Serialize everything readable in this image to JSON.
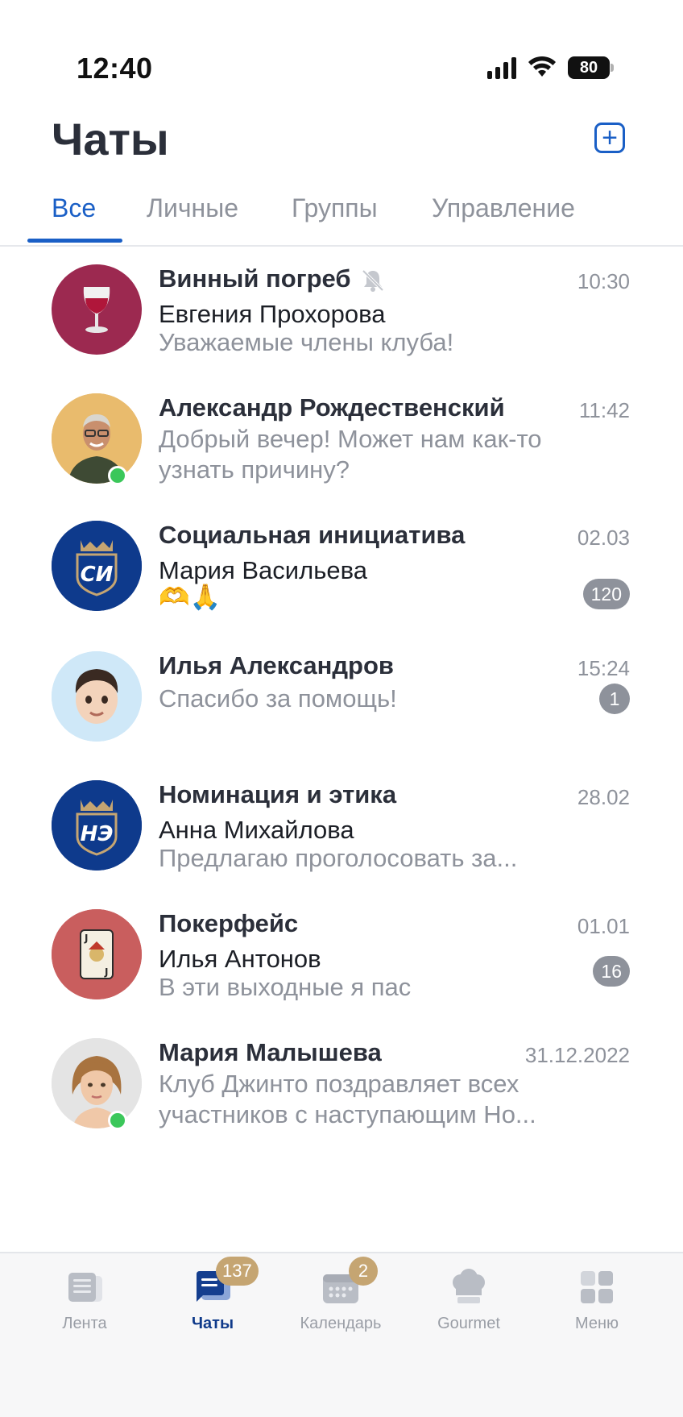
{
  "status_bar": {
    "time": "12:40",
    "battery": "80"
  },
  "header": {
    "title": "Чаты"
  },
  "tabs": [
    {
      "label": "Все",
      "active": true
    },
    {
      "label": "Личные",
      "active": false
    },
    {
      "label": "Группы",
      "active": false
    },
    {
      "label": "Управление",
      "active": false
    }
  ],
  "chats": [
    {
      "name": "Винный погреб",
      "muted": true,
      "time": "10:30",
      "sender": "Евгения Прохорова",
      "message": "Уважаемые члены клуба!",
      "unread": null,
      "avatar": "wine-glass",
      "avatar_color": "#9c2950"
    },
    {
      "name": "Александр Рождественский",
      "time": "11:42",
      "message": "Добрый вечер! Может нам как-то узнать причину?",
      "unread": null,
      "avatar": "person-photo",
      "online": true
    },
    {
      "name": "Социальная инициатива",
      "time": "02.03",
      "sender": "Мария Васильева",
      "message": "🫶🙏",
      "unread": "120",
      "avatar": "crest",
      "avatar_text": "СИ",
      "avatar_color": "#0e3a8c"
    },
    {
      "name": "Илья Александров",
      "time": "15:24",
      "message": "Спасибо за помощь!",
      "unread": "1",
      "avatar": "memoji"
    },
    {
      "name": "Номинация и этика",
      "time": "28.02",
      "sender": "Анна Михайлова",
      "message": "Предлагаю проголосовать за...",
      "unread": null,
      "avatar": "crest",
      "avatar_text": "НЭ",
      "avatar_color": "#0e3a8c"
    },
    {
      "name": "Покерфейс",
      "time": "01.01",
      "sender": "Илья Антонов",
      "message": "В эти выходные я пас",
      "unread": "16",
      "avatar": "joker-card",
      "avatar_color": "#c95e5e"
    },
    {
      "name": "Мария Малышева",
      "time": "31.12.2022",
      "message": "Клуб Джинто поздравляет всех участников с наступающим Но...",
      "unread": null,
      "avatar": "person-photo",
      "online": true
    }
  ],
  "tabbar": [
    {
      "label": "Лента",
      "icon": "feed-icon",
      "active": false,
      "badge": null
    },
    {
      "label": "Чаты",
      "icon": "chat-icon",
      "active": true,
      "badge": "137"
    },
    {
      "label": "Календарь",
      "icon": "calendar-icon",
      "active": false,
      "badge": "2"
    },
    {
      "label": "Gourmet",
      "icon": "chef-hat-icon",
      "active": false,
      "badge": null
    },
    {
      "label": "Меню",
      "icon": "grid-icon",
      "active": false,
      "badge": null
    }
  ],
  "colors": {
    "accent": "#1a5fc6",
    "badge_gold": "#c5a572",
    "online": "#3bc75a",
    "muted_text": "#8e929b"
  }
}
